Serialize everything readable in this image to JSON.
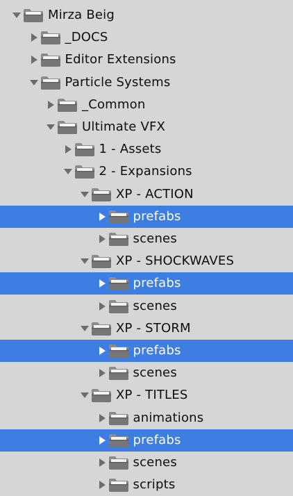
{
  "tree": {
    "items": [
      {
        "label": "Mirza Beig",
        "depth": 0,
        "expanded": true,
        "selected": false,
        "icon": "folder-icon"
      },
      {
        "label": "_DOCS",
        "depth": 1,
        "expanded": false,
        "selected": false,
        "icon": "folder-icon"
      },
      {
        "label": "Editor Extensions",
        "depth": 1,
        "expanded": false,
        "selected": false,
        "icon": "folder-icon"
      },
      {
        "label": "Particle Systems",
        "depth": 1,
        "expanded": true,
        "selected": false,
        "icon": "folder-icon"
      },
      {
        "label": "_Common",
        "depth": 2,
        "expanded": false,
        "selected": false,
        "icon": "folder-icon"
      },
      {
        "label": "Ultimate VFX",
        "depth": 2,
        "expanded": true,
        "selected": false,
        "icon": "folder-icon"
      },
      {
        "label": "1 - Assets",
        "depth": 3,
        "expanded": false,
        "selected": false,
        "icon": "folder-icon"
      },
      {
        "label": "2 - Expansions",
        "depth": 3,
        "expanded": true,
        "selected": false,
        "icon": "folder-icon"
      },
      {
        "label": "XP - ACTION",
        "depth": 4,
        "expanded": true,
        "selected": false,
        "icon": "folder-icon"
      },
      {
        "label": "prefabs",
        "depth": 5,
        "expanded": false,
        "selected": true,
        "icon": "folder-icon"
      },
      {
        "label": "scenes",
        "depth": 5,
        "expanded": false,
        "selected": false,
        "icon": "folder-icon"
      },
      {
        "label": "XP - SHOCKWAVES",
        "depth": 4,
        "expanded": true,
        "selected": false,
        "icon": "folder-icon"
      },
      {
        "label": "prefabs",
        "depth": 5,
        "expanded": false,
        "selected": true,
        "icon": "folder-icon"
      },
      {
        "label": "scenes",
        "depth": 5,
        "expanded": false,
        "selected": false,
        "icon": "folder-icon"
      },
      {
        "label": "XP - STORM",
        "depth": 4,
        "expanded": true,
        "selected": false,
        "icon": "folder-icon"
      },
      {
        "label": "prefabs",
        "depth": 5,
        "expanded": false,
        "selected": true,
        "icon": "folder-icon"
      },
      {
        "label": "scenes",
        "depth": 5,
        "expanded": false,
        "selected": false,
        "icon": "folder-icon"
      },
      {
        "label": "XP - TITLES",
        "depth": 4,
        "expanded": true,
        "selected": false,
        "icon": "folder-icon"
      },
      {
        "label": "animations",
        "depth": 5,
        "expanded": false,
        "selected": false,
        "icon": "folder-icon"
      },
      {
        "label": "prefabs",
        "depth": 5,
        "expanded": false,
        "selected": true,
        "icon": "folder-icon"
      },
      {
        "label": "scenes",
        "depth": 5,
        "expanded": false,
        "selected": false,
        "icon": "folder-icon"
      },
      {
        "label": "scripts",
        "depth": 5,
        "expanded": false,
        "selected": false,
        "icon": "folder-icon"
      }
    ]
  },
  "colors": {
    "background": "#d6d6d6",
    "selection": "#3e7de1",
    "text": "#0d0d0d",
    "selected_text": "#ffffff",
    "folder_body": "#767676",
    "folder_tab": "#8c8c8c",
    "arrow": "#6c6c6c"
  }
}
